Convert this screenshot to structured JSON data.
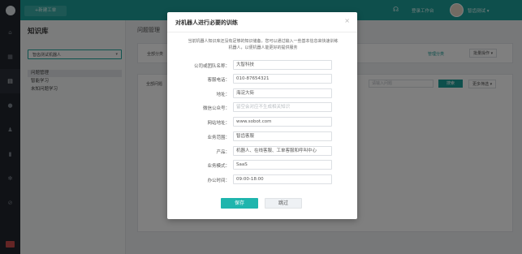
{
  "topbar": {
    "new_ticket": "+新建工单",
    "workspace": "登录工作台",
    "user": "智齿测试",
    "user_caret": "▾"
  },
  "rail": {
    "icons": [
      "home-icon",
      "grid-icon",
      "book-icon",
      "user-icon",
      "users-icon",
      "chart-icon",
      "gear-icon",
      "link-icon"
    ]
  },
  "kb": {
    "title": "知识库",
    "robot_select": "智齿测试机器人",
    "robot_caret": "▾",
    "items": [
      "问题管理",
      "智能学习",
      "未知问题学习"
    ]
  },
  "main": {
    "title": "问题管理",
    "filter_all": "全部分类",
    "manage_category": "管理分类",
    "batch_ops": "批量操作 ▾",
    "all_questions": "全部问题",
    "search_placeholder": "请输入问题",
    "search_btn": "搜索",
    "more_filters": "更多筛选 ▾"
  },
  "modal": {
    "title": "对机器人进行必要的训练",
    "close": "×",
    "description": "当前机器人知识库还没有足够的知识储备，您可以通过输入一些基本信息来快速训练机器人，以便机器人能更好的提供服务",
    "fields": [
      {
        "label": "公司或团队名称：",
        "value": "大智科技",
        "placeholder": false
      },
      {
        "label": "客服电话：",
        "value": "010-87654321",
        "placeholder": false
      },
      {
        "label": "地址：",
        "value": "海淀大街",
        "placeholder": false
      },
      {
        "label": "微信公众号：",
        "value": "留空会对应不生成相关知识",
        "placeholder": true
      },
      {
        "label": "网站地址：",
        "value": "www.sobot.com",
        "placeholder": false
      },
      {
        "label": "业务范围：",
        "value": "智齿客服",
        "placeholder": false
      },
      {
        "label": "产品：",
        "value": "机器人、在线客服、工单客服和呼叫中心",
        "placeholder": false
      },
      {
        "label": "业务模式：",
        "value": "SaaS",
        "placeholder": false
      },
      {
        "label": "办公时间：",
        "value": "09:00-18:00",
        "placeholder": false
      }
    ],
    "save": "保存",
    "skip": "跳过"
  }
}
